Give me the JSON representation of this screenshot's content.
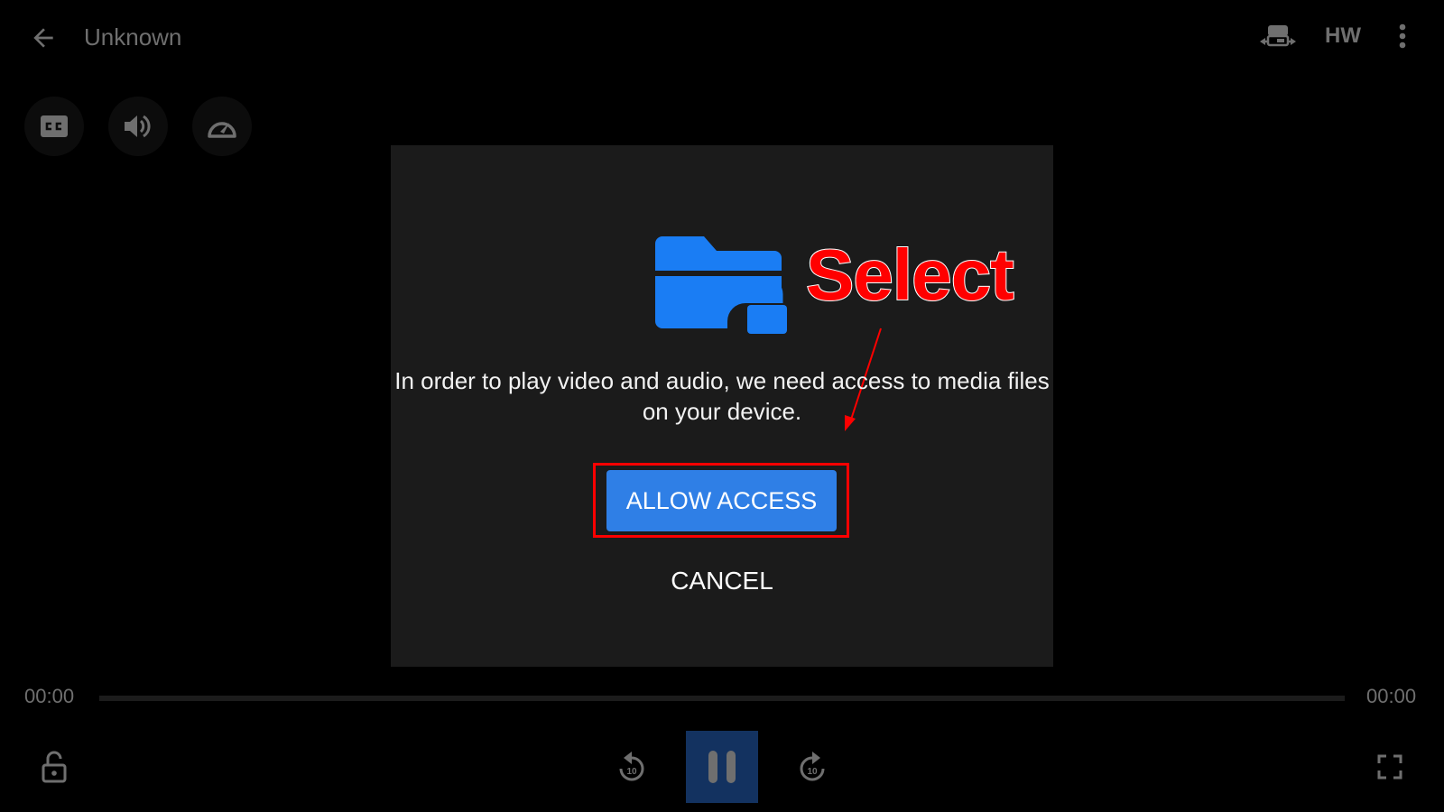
{
  "header": {
    "title": "Unknown",
    "hw_label": "HW",
    "icons": {
      "back": "arrow-left-icon",
      "rotate": "screen-rotation-icon",
      "more": "more-vert-icon"
    }
  },
  "quick_controls": [
    {
      "name": "subtitles",
      "icon": "closed-captions-icon"
    },
    {
      "name": "audio",
      "icon": "volume-icon"
    },
    {
      "name": "playback-speed",
      "icon": "speedometer-icon"
    }
  ],
  "dialog": {
    "icon": "folder-lock-icon",
    "message": "In order to play video and audio, we need access to media files on your device.",
    "allow_label": "ALLOW ACCESS",
    "cancel_label": "CANCEL"
  },
  "annotation": {
    "label": "Select",
    "color": "#ff0000"
  },
  "playback": {
    "current_time": "00:00",
    "total_time": "00:00",
    "progress": 0,
    "controls": {
      "lock": "lock-open-icon",
      "rewind": "replay-10-icon",
      "pause": "pause-icon",
      "forward": "forward-10-icon",
      "fullscreen": "fullscreen-icon"
    }
  },
  "colors": {
    "accent": "#2f7fe6",
    "dialog_bg": "#1b1b1b",
    "pause_bg": "#133260",
    "icon_gray": "#6f6f6f",
    "annotation_red": "#ff0000"
  }
}
